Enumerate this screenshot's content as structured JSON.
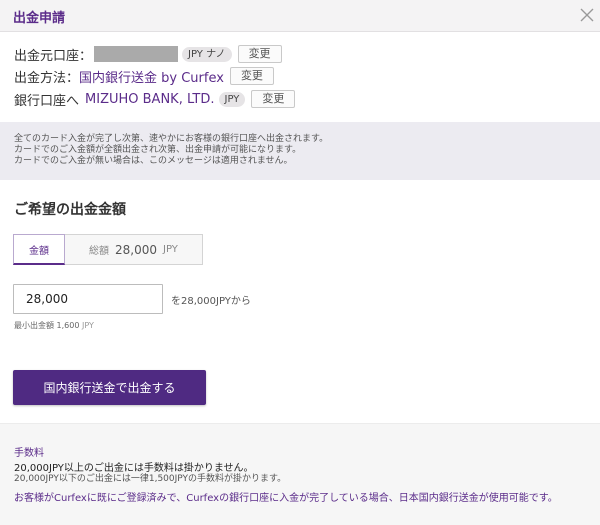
{
  "colors": {
    "accent": "#5b2c8a",
    "button": "#4f2a82"
  },
  "header": {
    "title": "出金申請",
    "close_icon": "close-icon"
  },
  "source_account": {
    "label": "出金元口座：",
    "badge": "JPY ナノ",
    "change_label": "変更"
  },
  "method": {
    "label": "出金方法：",
    "value": "国内銀行送金 by Curfex",
    "change_label": "変更"
  },
  "bank_account": {
    "label": "銀行口座へ",
    "value": "MIZUHO BANK, LTD.",
    "badge": "JPY",
    "change_label": "変更"
  },
  "notice": {
    "lines": [
      "全てのカード入金が完了し次第、速やかにお客様の銀行口座へ出金されます。",
      "カードでのご入金額が全額出金され次第、出金申請が可能になります。",
      "カードでのご入金が無い場合は、このメッセージは適用されません。"
    ]
  },
  "amount_section": {
    "title": "ご希望の出金金額",
    "tab_amount_label": "金額",
    "tab_total_label": "総額",
    "tab_total_value": "28,000",
    "tab_total_unit": "JPY",
    "input_value": "28,000",
    "from_note": "を28,000JPYから",
    "min_label": "最小出金額",
    "min_value": "1,600",
    "min_unit": "JPY"
  },
  "submit": {
    "label": "国内銀行送金で出金する"
  },
  "fees": {
    "title": "手数料",
    "line1": "20,000JPY以上のご出金には手数料は掛かりません。",
    "line2": "20,000JPY以下のご出金には一律1,500JPYの手数料が掛かります。",
    "bank_note": "お客様がCurfexに既にご登録済みで、Curfexの銀行口座に入金が完了している場合、日本国内銀行送金が使用可能です。"
  }
}
